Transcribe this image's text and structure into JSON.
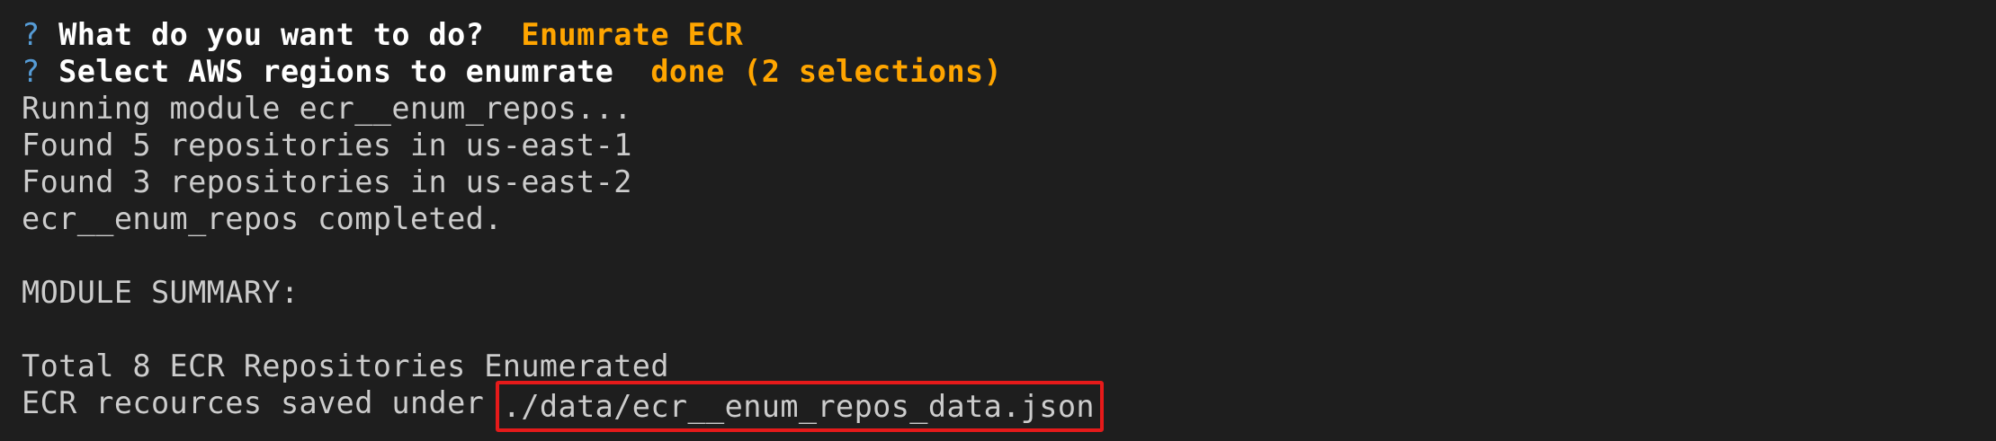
{
  "terminal": {
    "prompts": [
      {
        "marker": "?",
        "question": "What do you want to do?",
        "answer": "Enumrate ECR"
      },
      {
        "marker": "?",
        "question": "Select AWS regions to enumrate",
        "answer": "done (2 selections)"
      }
    ],
    "output": [
      "Running module ecr__enum_repos...",
      "Found 5 repositories in us-east-1",
      "Found 3 repositories in us-east-2",
      "ecr__enum_repos completed."
    ],
    "summary_heading": "MODULE SUMMARY:",
    "summary_total": "Total 8 ECR Repositories Enumerated",
    "saved_prefix": "ECR recources saved under",
    "saved_path": "./data/ecr__enum_repos_data.json"
  },
  "colors": {
    "background": "#1e1e1e",
    "text": "#cccccc",
    "question_marker": "#569cd6",
    "answer": "#ffa500",
    "highlight_box": "#e51a1a"
  }
}
